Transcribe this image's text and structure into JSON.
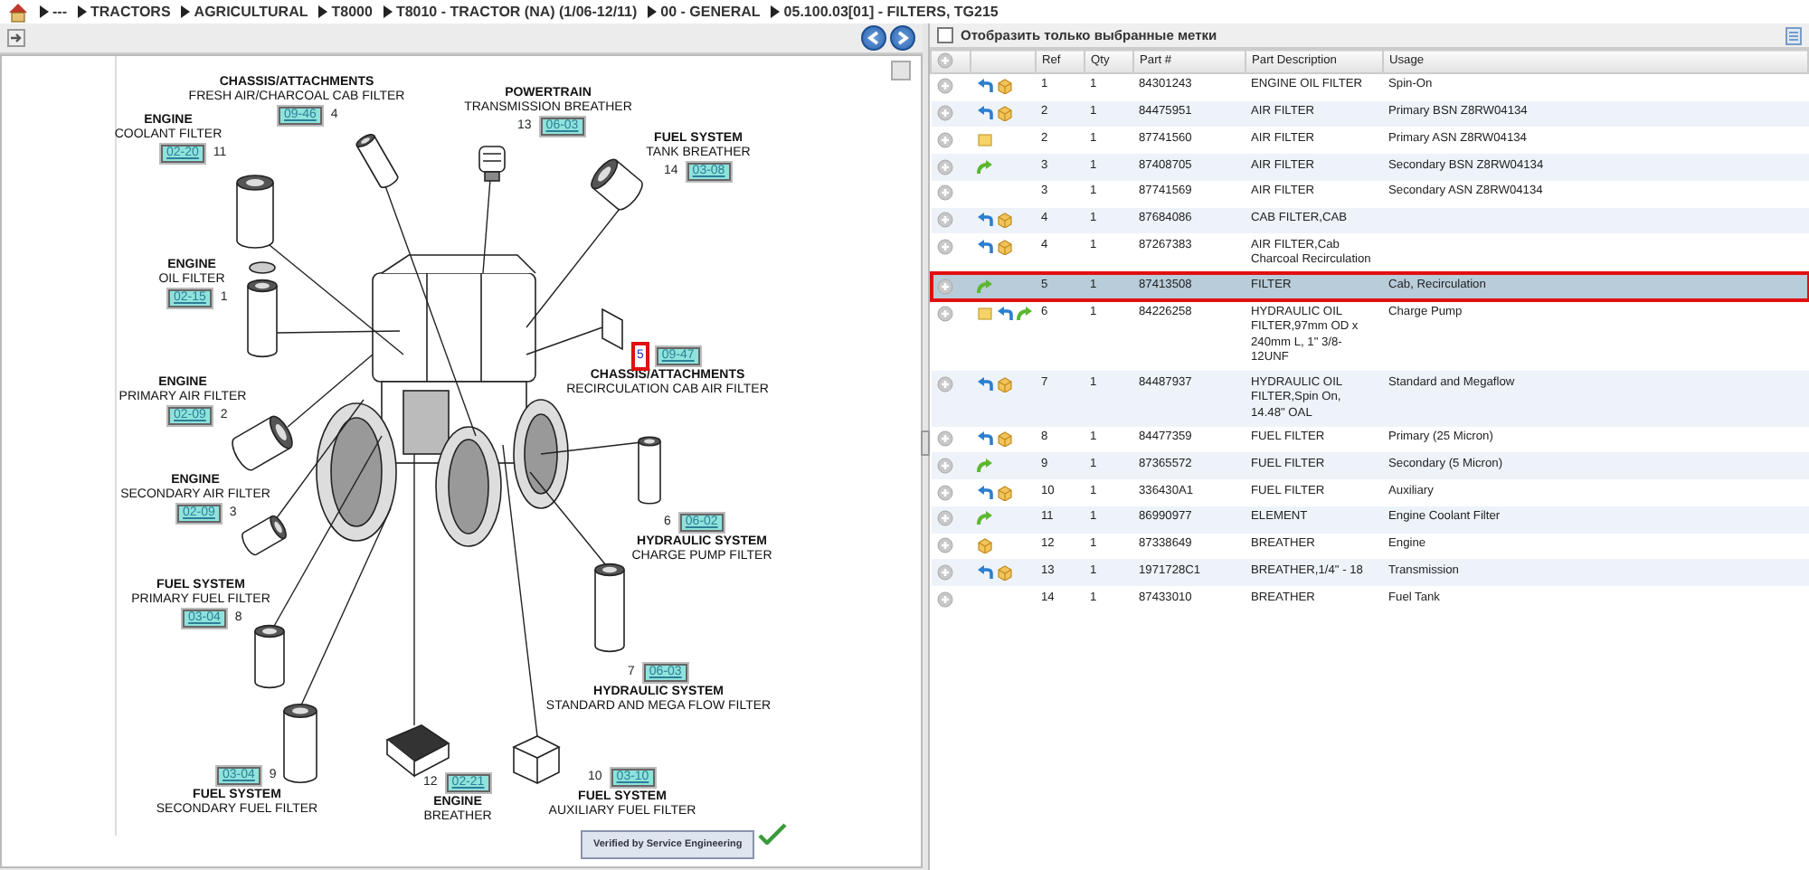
{
  "breadcrumb": [
    "---",
    "TRACTORS",
    "AGRICULTURAL",
    "T8000",
    "T8010 - TRACTOR (NA) (1/06-12/11)",
    "00 - GENERAL",
    "05.100.03[01] - FILTERS, TG215"
  ],
  "diagram": {
    "callouts": [
      {
        "system": "CHASSIS/ATTACHMENTS",
        "part": "FRESH AIR/CHARCOAL CAB FILTER",
        "code": "09-46",
        "ref": "4",
        "selected": false
      },
      {
        "system": "ENGINE",
        "part": "COOLANT FILTER",
        "code": "02-20",
        "ref": "11",
        "selected": false
      },
      {
        "system": "POWERTRAIN",
        "part": "TRANSMISSION BREATHER",
        "code": "06-03",
        "ref": "13",
        "selected": false
      },
      {
        "system": "FUEL SYSTEM",
        "part": "TANK BREATHER",
        "code": "03-08",
        "ref": "14",
        "selected": false
      },
      {
        "system": "ENGINE",
        "part": "OIL FILTER",
        "code": "02-15",
        "ref": "1",
        "selected": false
      },
      {
        "system": "CHASSIS/ATTACHMENTS",
        "part": "RECIRCULATION CAB AIR FILTER",
        "code": "09-47",
        "ref": "5",
        "selected": true
      },
      {
        "system": "ENGINE",
        "part": "PRIMARY AIR FILTER",
        "code": "02-09",
        "ref": "2",
        "selected": false
      },
      {
        "system": "ENGINE",
        "part": "SECONDARY AIR FILTER",
        "code": "02-09",
        "ref": "3",
        "selected": false
      },
      {
        "system": "HYDRAULIC SYSTEM",
        "part": "CHARGE PUMP FILTER",
        "code": "06-02",
        "ref": "6",
        "selected": false
      },
      {
        "system": "FUEL SYSTEM",
        "part": "PRIMARY FUEL FILTER",
        "code": "03-04",
        "ref": "8",
        "selected": false
      },
      {
        "system": "HYDRAULIC SYSTEM",
        "part": "STANDARD AND MEGA FLOW FILTER",
        "code": "06-03",
        "ref": "7",
        "selected": false
      },
      {
        "system": "FUEL SYSTEM",
        "part": "SECONDARY FUEL FILTER",
        "code": "03-04",
        "ref": "9",
        "selected": false
      },
      {
        "system": "ENGINE",
        "part": "BREATHER",
        "code": "02-21",
        "ref": "12",
        "selected": false
      },
      {
        "system": "FUEL SYSTEM",
        "part": "AUXILIARY FUEL FILTER",
        "code": "03-10",
        "ref": "10",
        "selected": false
      }
    ],
    "verified": "Verified by Service Engineering"
  },
  "filter": {
    "label": "Отобразить только выбранные метки",
    "checked": false
  },
  "table": {
    "columns": [
      "Ref",
      "Qty",
      "Part #",
      "Part Description",
      "Usage"
    ],
    "rows": [
      {
        "icons": [
          {
            "kind": "return"
          },
          {
            "kind": "package"
          }
        ],
        "ref": "1",
        "qty": "1",
        "part": "84301243",
        "description": "ENGINE OIL FILTER",
        "usage": "Spin-On",
        "selected": false
      },
      {
        "icons": [
          {
            "kind": "return"
          },
          {
            "kind": "package"
          }
        ],
        "ref": "2",
        "qty": "1",
        "part": "84475951",
        "description": "AIR FILTER",
        "usage": "Primary BSN Z8RW04134",
        "selected": false
      },
      {
        "icons": [
          {
            "kind": "note"
          }
        ],
        "ref": "2",
        "qty": "1",
        "part": "87741560",
        "description": "AIR FILTER",
        "usage": "Primary ASN Z8RW04134",
        "selected": false
      },
      {
        "icons": [
          {
            "kind": "forward"
          }
        ],
        "ref": "3",
        "qty": "1",
        "part": "87408705",
        "description": "AIR FILTER",
        "usage": "Secondary BSN Z8RW04134",
        "selected": false
      },
      {
        "icons": [],
        "ref": "3",
        "qty": "1",
        "part": "87741569",
        "description": "AIR FILTER",
        "usage": "Secondary ASN Z8RW04134",
        "selected": false
      },
      {
        "icons": [
          {
            "kind": "return"
          },
          {
            "kind": "package"
          }
        ],
        "ref": "4",
        "qty": "1",
        "part": "87684086",
        "description": "CAB FILTER,CAB",
        "selected": false
      },
      {
        "icons": [
          {
            "kind": "return"
          },
          {
            "kind": "package"
          }
        ],
        "ref": "4",
        "qty": "1",
        "part": "87267383",
        "description": "AIR FILTER,Cab Charcoal Recirculation",
        "selected": false
      },
      {
        "icons": [
          {
            "kind": "forward"
          }
        ],
        "ref": "5",
        "qty": "1",
        "part": "87413508",
        "description": "FILTER",
        "usage": "Cab, Recirculation",
        "selected": true
      },
      {
        "icons": [
          {
            "kind": "note"
          },
          {
            "kind": "return"
          },
          {
            "kind": "forward"
          }
        ],
        "ref": "6",
        "qty": "1",
        "part": "84226258",
        "description": "HYDRAULIC OIL FILTER,97mm OD x 240mm L, 1\" 3/8-12UNF",
        "usage": "Charge Pump",
        "selected": false
      },
      {
        "icons": [
          {
            "kind": "return"
          },
          {
            "kind": "package"
          }
        ],
        "ref": "7",
        "qty": "1",
        "part": "84487937",
        "description": "HYDRAULIC OIL FILTER,Spin On, 14.48\" OAL",
        "usage": "Standard and Megaflow",
        "selected": false
      },
      {
        "icons": [
          {
            "kind": "return"
          },
          {
            "kind": "package"
          }
        ],
        "ref": "8",
        "qty": "1",
        "part": "84477359",
        "description": "FUEL FILTER",
        "usage": "Primary (25 Micron)",
        "selected": false
      },
      {
        "icons": [
          {
            "kind": "forward"
          }
        ],
        "ref": "9",
        "qty": "1",
        "part": "87365572",
        "description": "FUEL FILTER",
        "usage": "Secondary (5 Micron)",
        "selected": false
      },
      {
        "icons": [
          {
            "kind": "return"
          },
          {
            "kind": "package"
          }
        ],
        "ref": "10",
        "qty": "1",
        "part": "336430A1",
        "description": "FUEL FILTER",
        "usage": "Auxiliary",
        "selected": false
      },
      {
        "icons": [
          {
            "kind": "forward"
          }
        ],
        "ref": "11",
        "qty": "1",
        "part": "86990977",
        "description": "ELEMENT",
        "usage": "Engine Coolant Filter",
        "selected": false
      },
      {
        "icons": [
          {
            "kind": "package"
          }
        ],
        "ref": "12",
        "qty": "1",
        "part": "87338649",
        "description": "BREATHER",
        "usage": "Engine",
        "selected": false
      },
      {
        "icons": [
          {
            "kind": "return"
          },
          {
            "kind": "package"
          }
        ],
        "ref": "13",
        "qty": "1",
        "part": "1971728C1",
        "description": "BREATHER,1/4\" - 18",
        "usage": "Transmission",
        "selected": false
      },
      {
        "icons": [],
        "ref": "14",
        "qty": "1",
        "part": "87433010",
        "description": "BREATHER",
        "usage": "Fuel Tank",
        "selected": false
      }
    ]
  }
}
